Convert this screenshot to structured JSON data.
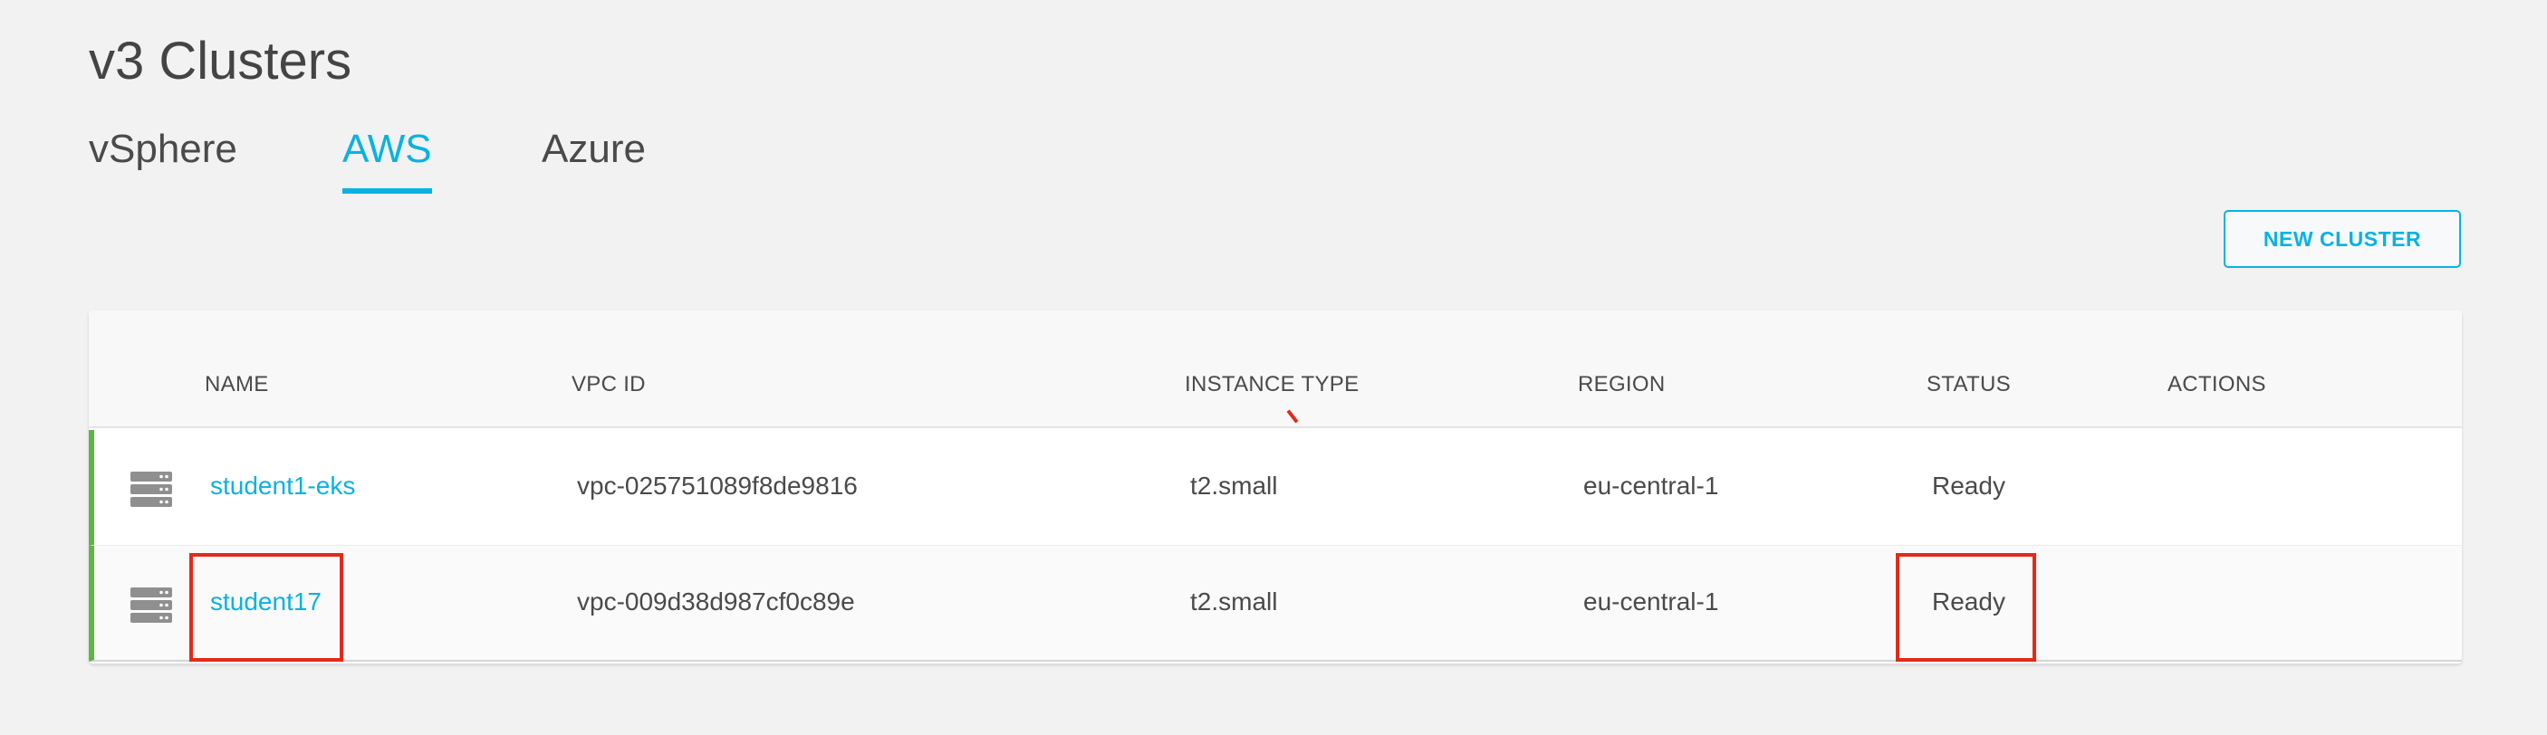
{
  "page": {
    "title": "v3 Clusters"
  },
  "tabs": [
    {
      "label": "vSphere",
      "active": false
    },
    {
      "label": "AWS",
      "active": true
    },
    {
      "label": "Azure",
      "active": false
    }
  ],
  "toolbar": {
    "new_cluster_label": "NEW CLUSTER"
  },
  "table": {
    "headers": {
      "name": "NAME",
      "vpc_id": "VPC ID",
      "instance_type": "INSTANCE TYPE",
      "region": "REGION",
      "status": "STATUS",
      "actions": "ACTIONS"
    },
    "rows": [
      {
        "icon": "server-icon",
        "name": "student1-eks",
        "vpc_id": "vpc-025751089f8de9816",
        "instance_type": "t2.small",
        "region": "eu-central-1",
        "status": "Ready"
      },
      {
        "icon": "server-icon",
        "name": "student17",
        "vpc_id": "vpc-009d38d987cf0c89e",
        "instance_type": "t2.small",
        "region": "eu-central-1",
        "status": "Ready"
      }
    ]
  },
  "colors": {
    "accent": "#0ab2e0",
    "status_ready_bar": "#62b347",
    "highlight": "#e32a1a",
    "background": "#f2f2f2"
  }
}
